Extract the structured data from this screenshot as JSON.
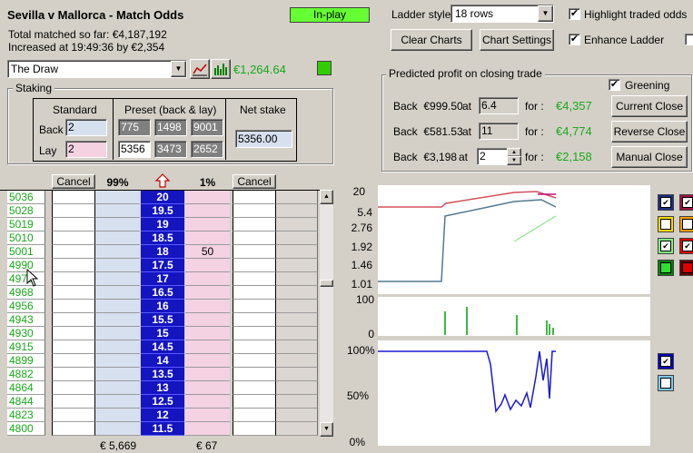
{
  "header": {
    "title": "Sevilla v Mallorca - Match Odds",
    "inplay": "In-play",
    "total_matched": "Total matched so far: €4,187,192",
    "increased": "Increased at 19:49:36 by €2,354",
    "ladder_style_label": "Ladder style",
    "ladder_style_value": "18 rows",
    "highlight_label": "Highlight traded odds",
    "enhance_label": "Enhance Ladder",
    "clear_charts": "Clear Charts",
    "chart_settings": "Chart Settings"
  },
  "selection": {
    "value": "The Draw",
    "amount": "€1,264.64"
  },
  "staking": {
    "title": "Staking",
    "standard": "Standard",
    "preset": "Preset (back & lay)",
    "net_stake": "Net stake",
    "back_label": "Back",
    "lay_label": "Lay",
    "back_value": "2",
    "lay_value": "2",
    "preset_back": [
      "775",
      "1498",
      "9001"
    ],
    "preset_lay": [
      "5356",
      "3473",
      "2652"
    ],
    "net_value": "5356.00"
  },
  "profit": {
    "title": "Predicted profit on closing trade",
    "greening": "Greening",
    "for_label": "for :",
    "at_label": "at",
    "rows": [
      {
        "back": "Back  €999.50",
        "odds": "6.4",
        "profit": "€4,357",
        "button": "Current Close"
      },
      {
        "back": "Back  €581.53",
        "odds": "11",
        "profit": "€4,774",
        "button": "Reverse Close"
      },
      {
        "back": "Back  €3,198",
        "odds": "2",
        "profit": "€2,158",
        "button": "Manual Close"
      }
    ]
  },
  "ladder": {
    "cancel": "Cancel",
    "back_pct": "99%",
    "lay_pct": "1%",
    "back_total": "€ 5,669",
    "lay_total": "€ 67",
    "rows": [
      {
        "vol": "5036",
        "price": "20",
        "lay": ""
      },
      {
        "vol": "5028",
        "price": "19.5",
        "lay": ""
      },
      {
        "vol": "5019",
        "price": "19",
        "lay": ""
      },
      {
        "vol": "5010",
        "price": "18.5",
        "lay": ""
      },
      {
        "vol": "5001",
        "price": "18",
        "lay": "50"
      },
      {
        "vol": "4990",
        "price": "17.5",
        "lay": ""
      },
      {
        "vol": "4979",
        "price": "17",
        "lay": ""
      },
      {
        "vol": "4968",
        "price": "16.5",
        "lay": ""
      },
      {
        "vol": "4956",
        "price": "16",
        "lay": ""
      },
      {
        "vol": "4943",
        "price": "15.5",
        "lay": ""
      },
      {
        "vol": "4930",
        "price": "15",
        "lay": ""
      },
      {
        "vol": "4915",
        "price": "14.5",
        "lay": ""
      },
      {
        "vol": "4899",
        "price": "14",
        "lay": ""
      },
      {
        "vol": "4882",
        "price": "13.5",
        "lay": ""
      },
      {
        "vol": "4864",
        "price": "13",
        "lay": ""
      },
      {
        "vol": "4844",
        "price": "12.5",
        "lay": ""
      },
      {
        "vol": "4823",
        "price": "12",
        "lay": ""
      },
      {
        "vol": "4800",
        "price": "11.5",
        "lay": ""
      }
    ]
  },
  "charts": {
    "price_ticks": [
      "20",
      "5.4",
      "2.76",
      "1.92",
      "1.46",
      "1.01"
    ],
    "vol_ticks": [
      "100",
      "0"
    ],
    "pct_ticks": [
      "100%",
      "50%",
      "0%"
    ]
  },
  "colors": {
    "price_col": "#1414c0",
    "back_col": "#d6e0ef",
    "lay_col": "#f4d2e2",
    "green_text": "#18a818"
  }
}
